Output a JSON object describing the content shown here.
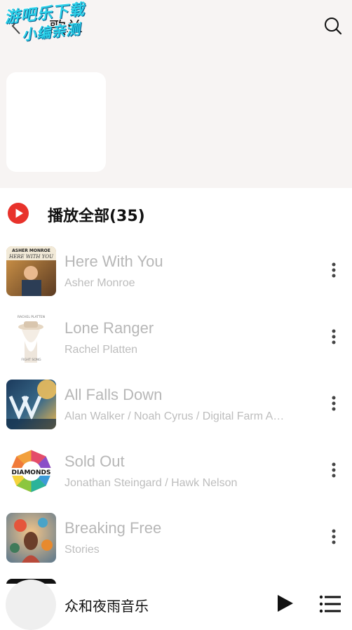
{
  "header": {
    "title": "歌单",
    "watermark_line1": "游吧乐下载",
    "watermark_line2": "小编亲测"
  },
  "play_all": {
    "label": "播放全部(35)"
  },
  "songs": [
    {
      "title": "Here With You",
      "artist": "Asher Monroe",
      "cover_text_top": "ASHER MONROE",
      "cover_text_main": "HERE WITH YOU"
    },
    {
      "title": "Lone Ranger",
      "artist": "Rachel Platten",
      "cover_text_top": "RACHEL PLATTEN",
      "cover_text_main": "FIGHT SONG"
    },
    {
      "title": "All Falls Down",
      "artist": "Alan Walker / Noah Cyrus / Digital Farm Ani...",
      "cover_text_top": "",
      "cover_text_main": ""
    },
    {
      "title": "Sold Out",
      "artist": "Jonathan Steingard / Hawk Nelson",
      "cover_text_top": "",
      "cover_text_main": "DIAMONDS"
    },
    {
      "title": "Breaking Free",
      "artist": "Stories",
      "cover_text_top": "",
      "cover_text_main": ""
    }
  ],
  "player": {
    "title": "众和夜雨音乐"
  },
  "colors": {
    "accent_red": "#e8322b",
    "header_bg": "#f7f4f3",
    "muted_text": "#b7b7b7",
    "watermark": "#2bd0e8"
  },
  "icons": {
    "back": "chevron-left-icon",
    "search": "search-icon",
    "play_all": "play-circle-icon",
    "more": "more-vertical-icon",
    "play": "play-icon",
    "playlist": "playlist-icon"
  }
}
